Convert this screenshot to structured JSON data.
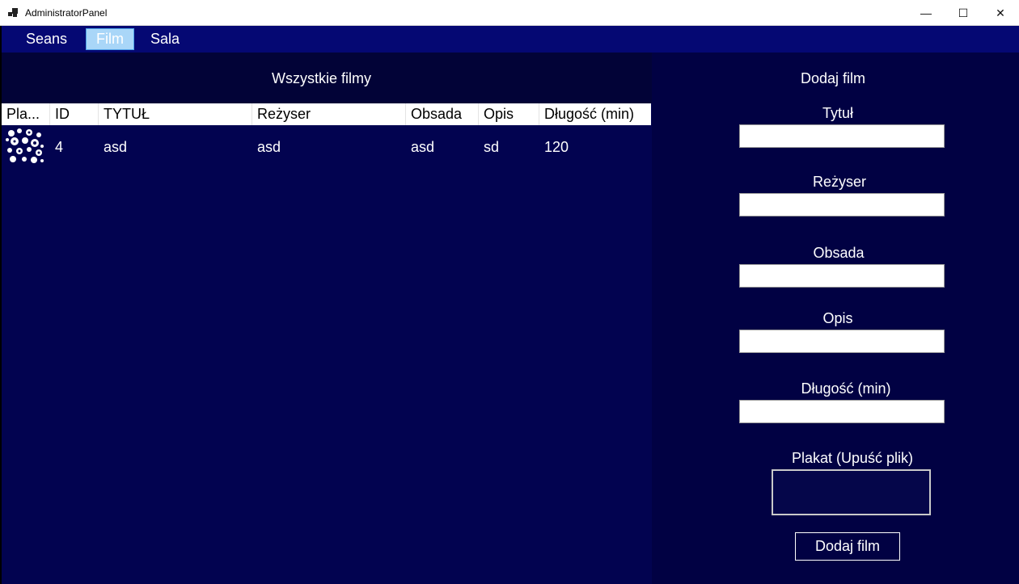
{
  "window": {
    "title": "AdministratorPanel",
    "minimize_glyph": "—",
    "maximize_glyph": "☐",
    "close_glyph": "✕"
  },
  "menu": {
    "items": [
      {
        "label": "Seans"
      },
      {
        "label": "Film",
        "active": true
      },
      {
        "label": "Sala"
      }
    ]
  },
  "films_list": {
    "title": "Wszystkie filmy",
    "columns": [
      "Pla...",
      "ID",
      "TYTUŁ",
      "Reżyser",
      "Obsada",
      "Opis",
      "Długość (min)"
    ],
    "rows": [
      {
        "plakat": "poster-thumbnail",
        "id": "4",
        "tytul": "asd",
        "rezyser": "asd",
        "obsada": "asd",
        "opis": "sd",
        "dlugosc": "120"
      }
    ]
  },
  "add_film": {
    "title": "Dodaj film",
    "fields": {
      "tytul": {
        "label": "Tytuł",
        "value": ""
      },
      "rezyser": {
        "label": "Reżyser",
        "value": ""
      },
      "obsada": {
        "label": "Obsada",
        "value": ""
      },
      "opis": {
        "label": "Opis",
        "value": ""
      },
      "dlugosc": {
        "label": "Długość (min)",
        "value": ""
      }
    },
    "poster_label": "Plakat (Upuść plik)",
    "submit_label": "Dodaj film"
  },
  "colors": {
    "menu_bar": "#050873",
    "list_background": "#020350",
    "form_background": "#010143",
    "active_menu": "#a9d6f8"
  }
}
